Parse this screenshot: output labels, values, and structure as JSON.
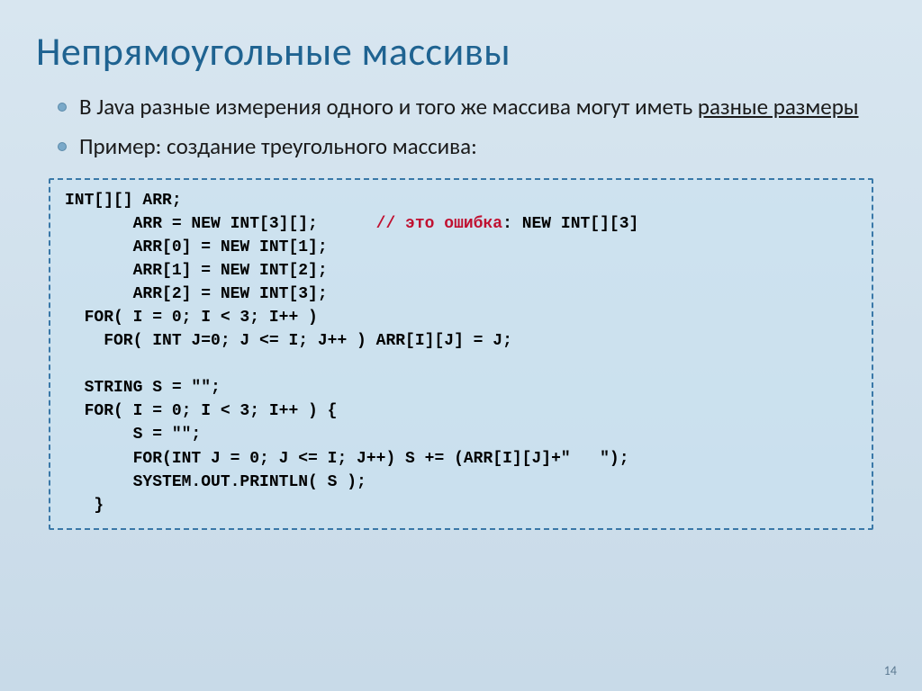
{
  "title": "Непрямоугольные массивы",
  "bullets": [
    {
      "pre": "В Java ",
      "bold": "разные измерения",
      "mid": " одного и того же массива могут иметь ",
      "uline": "разные размеры",
      "post": ""
    },
    {
      "pre": "Пример: создание треугольного массива:",
      "bold": "",
      "mid": "",
      "uline": "",
      "post": ""
    }
  ],
  "code": {
    "l1": "INT[][] ARR;",
    "l2a": "       ARR = NEW INT[3][];      ",
    "l2b": "// это ошибка",
    "l2c": ": NEW INT[][3]",
    "l3": "       ARR[0] = NEW INT[1];",
    "l4": "       ARR[1] = NEW INT[2];",
    "l5": "       ARR[2] = NEW INT[3];",
    "l6": "  FOR( I = 0; I < 3; I++ )",
    "l7": "    FOR( INT J=0; J <= I; J++ ) ARR[I][J] = J;",
    "l8": "",
    "l9": "  STRING S = \"\";",
    "l10": "  FOR( I = 0; I < 3; I++ ) {",
    "l11": "       S = \"\";",
    "l12": "       FOR(INT J = 0; J <= I; J++) S += (ARR[I][J]+\"   \");",
    "l13": "       SYSTEM.OUT.PRINTLN( S );",
    "l14": "   }"
  },
  "page_number": "14"
}
